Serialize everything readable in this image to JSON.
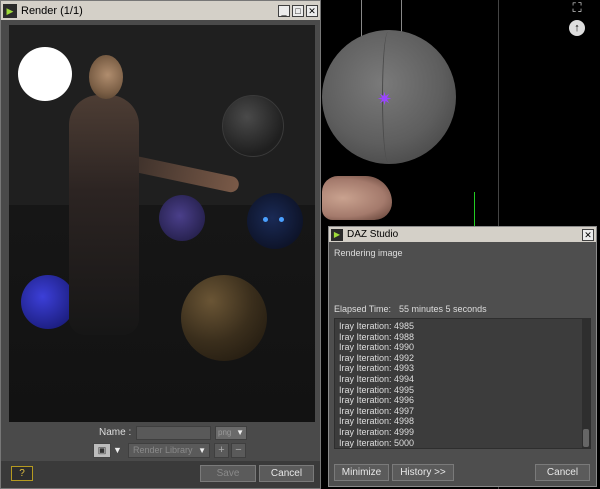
{
  "render_window": {
    "title": "Render (1/1)",
    "controls": {
      "minimize": "_",
      "maximize": "□",
      "close": "✕"
    },
    "name_label": "Name :",
    "name_value": "",
    "name_combo": "png",
    "library_combo": "Render Library",
    "add_label": "+",
    "remove_label": "−",
    "help_label": "?",
    "save_label": "Save",
    "cancel_label": "Cancel"
  },
  "daz_dialog": {
    "title": "DAZ Studio",
    "close": "✕",
    "status": "Rendering image",
    "elapsed_label": "Elapsed Time:",
    "elapsed_value": "55 minutes 5 seconds",
    "log": [
      "Iray Iteration: 4985",
      "Iray Iteration: 4988",
      "Iray Iteration: 4990",
      "Iray Iteration: 4992",
      "Iray Iteration: 4993",
      "Iray Iteration: 4994",
      "Iray Iteration: 4995",
      "Iray Iteration: 4996",
      "Iray Iteration: 4997",
      "Iray Iteration: 4998",
      "Iray Iteration: 4999",
      "Iray Iteration: 5000"
    ],
    "minimize_label": "Minimize",
    "history_label": "History >>",
    "cancel_label": "Cancel"
  },
  "viewport": {
    "icons": [
      "fullscreen-icon",
      "arrow-up-icon"
    ],
    "accent_star": "#9a44ff"
  }
}
